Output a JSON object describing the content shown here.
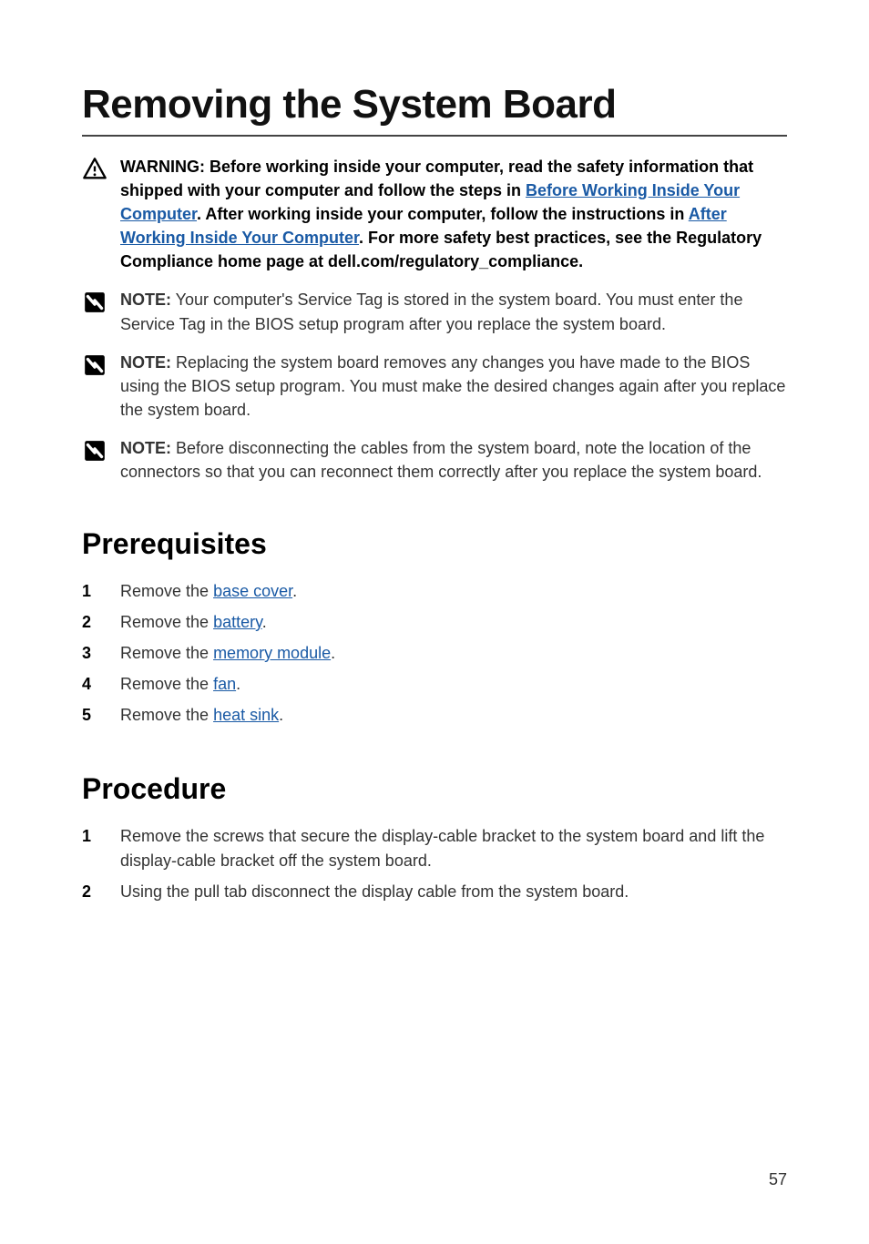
{
  "title": "Removing the System Board",
  "warning": {
    "prefix": "WARNING:",
    "p1": " Before working inside your computer, read the safety information that shipped with your computer and follow the steps in ",
    "link1": "Before Working Inside Your Computer",
    "p2": ". After working inside your computer, follow the instructions in ",
    "link2": "After Working Inside Your Computer",
    "p3": ". For more safety best practices, see the Regulatory Compliance home page at dell.com/regulatory_compliance."
  },
  "notes": [
    {
      "prefix": "NOTE:",
      "text": " Your computer's Service Tag is stored in the system board. You must enter the Service Tag in the BIOS setup program after you replace the system board."
    },
    {
      "prefix": "NOTE:",
      "text": " Replacing the system board removes any changes you have made to the BIOS using the BIOS setup program. You must make the desired changes again after you replace the system board."
    },
    {
      "prefix": "NOTE:",
      "text": " Before disconnecting the cables from the system board, note the location of the connectors so that you can reconnect them correctly after you replace the system board."
    }
  ],
  "sections": {
    "prereq_title": "Prerequisites",
    "prereq_items": [
      {
        "num": "1",
        "pre": "Remove the ",
        "link": "base cover",
        "post": "."
      },
      {
        "num": "2",
        "pre": "Remove the ",
        "link": "battery",
        "post": "."
      },
      {
        "num": "3",
        "pre": "Remove the ",
        "link": "memory module",
        "post": "."
      },
      {
        "num": "4",
        "pre": "Remove the ",
        "link": "fan",
        "post": "."
      },
      {
        "num": "5",
        "pre": "Remove the ",
        "link": "heat sink",
        "post": "."
      }
    ],
    "proc_title": "Procedure",
    "proc_items": [
      {
        "num": "1",
        "text": "Remove the screws that secure the display-cable bracket to the system board and lift the display-cable bracket off the system board."
      },
      {
        "num": "2",
        "text": "Using the pull tab disconnect the display cable from the system board."
      }
    ]
  },
  "page_number": "57"
}
